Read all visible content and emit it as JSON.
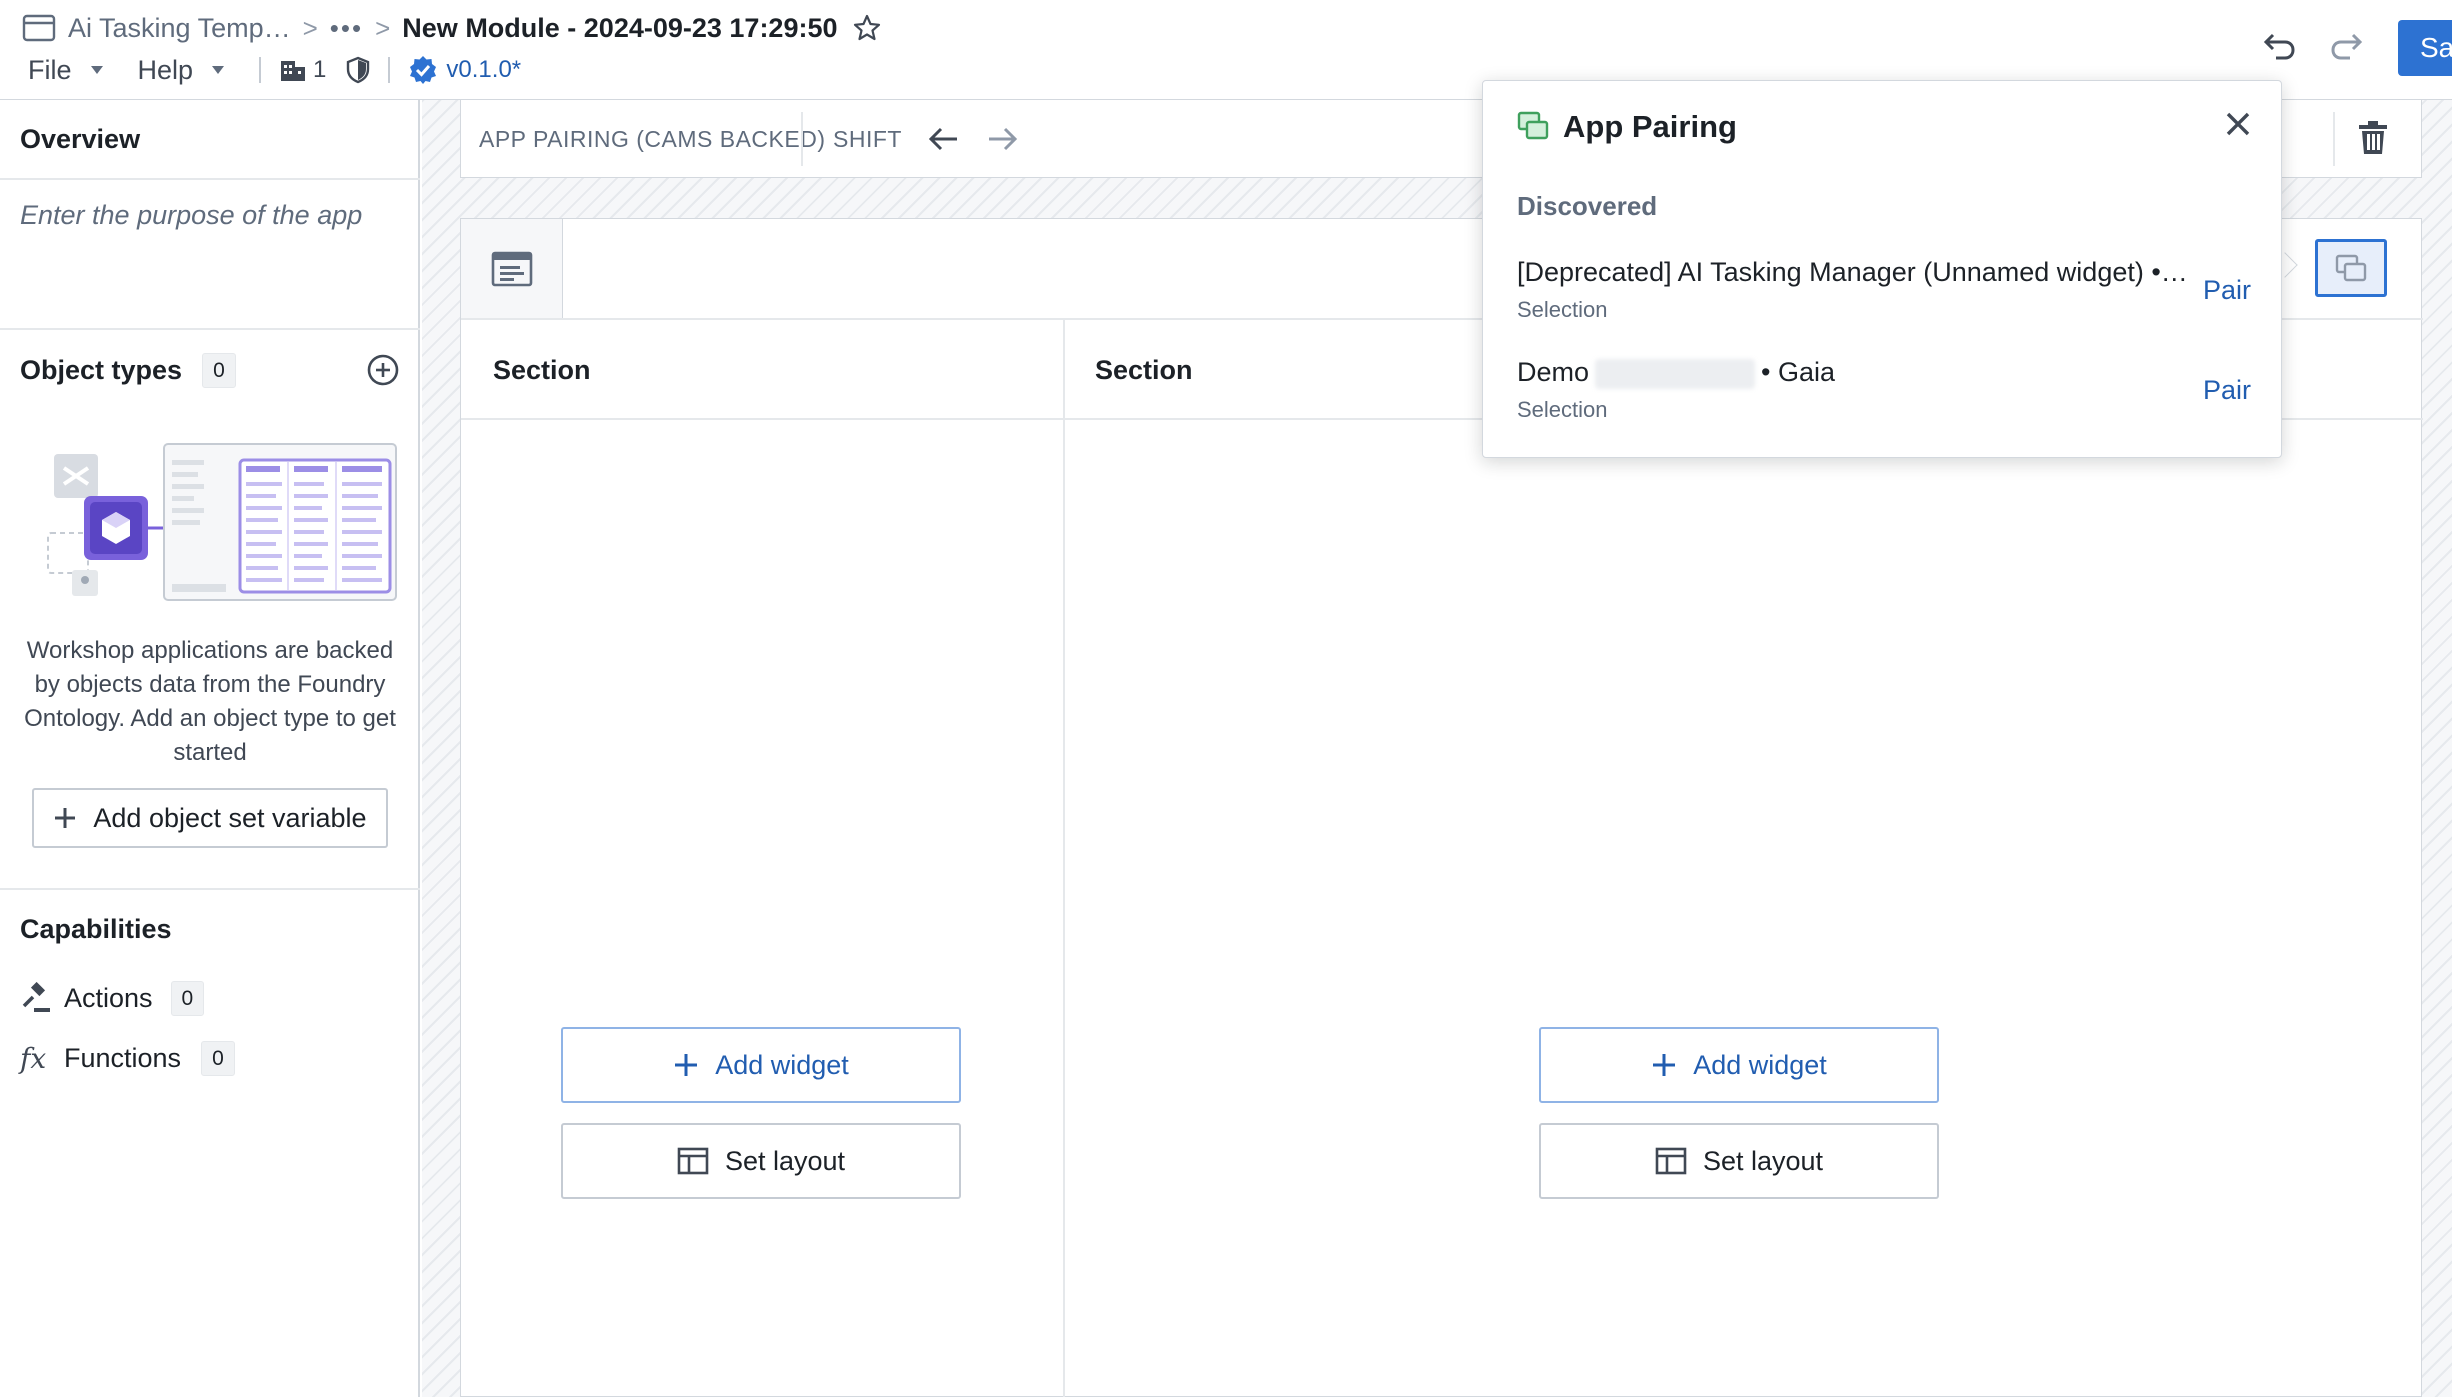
{
  "header": {
    "breadcrumb_app": "Ai Tasking Temp…",
    "breadcrumb_sep": ">",
    "breadcrumb_more": "•••",
    "module_title": "New Module - 2024-09-23 17:29:50",
    "menu": {
      "file": "File",
      "help": "Help"
    },
    "org_count": "1",
    "version": "v0.1.0*",
    "save_label": "Sa"
  },
  "sidebar": {
    "overview_title": "Overview",
    "overview_placeholder": "Enter the purpose of the app",
    "object_types_title": "Object types",
    "object_types_count": "0",
    "empty_state_text": "Workshop applications are backed by objects data from the Foundry Ontology. Add an object type to get started",
    "add_object_set_label": "Add object set variable",
    "capabilities_title": "Capabilities",
    "actions_label": "Actions",
    "actions_count": "0",
    "functions_label": "Functions",
    "functions_count": "0"
  },
  "page_toolbar": {
    "page_name": "APP PAIRING (CAMS BACKED)",
    "shift_label": "SHIFT"
  },
  "sections": [
    {
      "title": "Section",
      "add_widget": "Add widget",
      "set_layout": "Set layout"
    },
    {
      "title": "Section",
      "add_widget": "Add widget",
      "set_layout": "Set layout"
    }
  ],
  "popover": {
    "title": "App Pairing",
    "group_label": "Discovered",
    "items": [
      {
        "name": "[Deprecated] AI Tasking Manager (Unnamed widget) •…",
        "type": "Selection",
        "action": "Pair"
      },
      {
        "name_prefix": "Demo",
        "name_suffix": "• Gaia",
        "type": "Selection",
        "action": "Pair"
      }
    ]
  },
  "colors": {
    "accent": "#2d72d2",
    "link": "#215db0",
    "border": "#d3d8de",
    "illustration_purple": "#7961db",
    "pairing_green": "#3fa05d"
  },
  "icons": [
    "app-icon",
    "star-icon",
    "caret-down-icon",
    "building-icon",
    "shield-icon",
    "verified-icon",
    "undo-icon",
    "redo-icon",
    "add-circle-icon",
    "plus-icon",
    "gavel-icon",
    "function-icon",
    "arrow-left-icon",
    "arrow-right-icon",
    "trash-icon",
    "layout-icon",
    "pairing-icon",
    "close-icon"
  ]
}
